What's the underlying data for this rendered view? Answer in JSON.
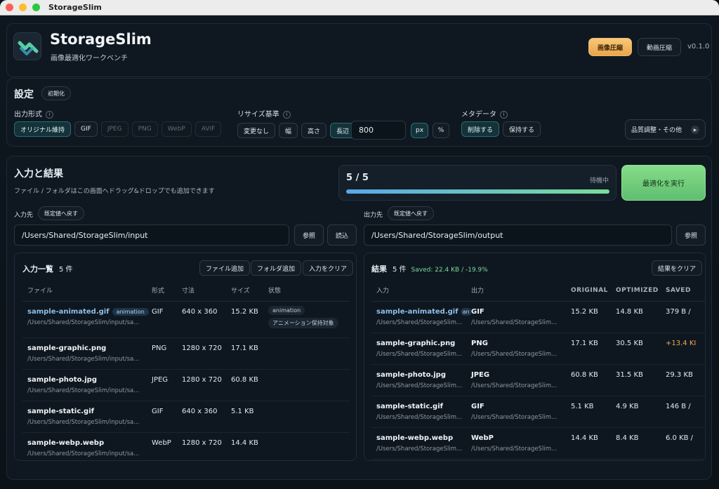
{
  "window": {
    "title": "StorageSlim"
  },
  "header": {
    "app_name": "StorageSlim",
    "subtitle": "画像最適化ワークベンチ",
    "tab_image": "画像圧縮",
    "tab_video": "動画圧縮",
    "version": "v0.1.0"
  },
  "settings": {
    "title": "設定",
    "reset": "初期化",
    "output_format": {
      "label": "出力形式",
      "info": "i",
      "options": [
        "オリジナル維持",
        "GIF",
        "JPEG",
        "PNG",
        "WebP",
        "AVIF"
      ],
      "selected": "オリジナル維持"
    },
    "resize": {
      "label": "リサイズ基準",
      "info": "i",
      "options": [
        "変更なし",
        "幅",
        "高さ",
        "長辺"
      ],
      "selected": "長辺",
      "value": "800",
      "unit_px": "px",
      "unit_pct": "%",
      "selected_unit": "px"
    },
    "metadata": {
      "label": "メタデータ",
      "info": "i",
      "options": [
        "削除する",
        "保持する"
      ],
      "selected": "削除する"
    },
    "quality_button": "品質調整・その他"
  },
  "io": {
    "title": "入力と結果",
    "hint": "ファイル / フォルダはこの画面へドラッグ&ドロップでも追加できます",
    "progress": {
      "text": "5 / 5",
      "status": "待機中",
      "fraction": 1.0
    },
    "run_button": "最適化を実行",
    "input_dir": {
      "label": "入力先",
      "reset": "既定値へ戻す",
      "value": "/Users/Shared/StorageSlim/input",
      "browse": "参照",
      "read": "読込"
    },
    "output_dir": {
      "label": "出力先",
      "reset": "既定値へ戻す",
      "value": "/Users/Shared/StorageSlim/output",
      "browse": "参照"
    }
  },
  "input_list": {
    "title": "入力一覧",
    "count": "5 件",
    "add_file": "ファイル追加",
    "add_folder": "フォルダ追加",
    "clear": "入力をクリア",
    "columns": [
      "ファイル",
      "形式",
      "寸法",
      "サイズ",
      "状態"
    ],
    "rows": [
      {
        "name": "sample-animated.gif",
        "badge": "animation",
        "path": "/Users/Shared/StorageSlim/input/sa...",
        "format": "GIF",
        "dims": "640 x 360",
        "size": "15.2 KB",
        "status1": "animation",
        "status2": "アニメーション保持対象"
      },
      {
        "name": "sample-graphic.png",
        "badge": "",
        "path": "/Users/Shared/StorageSlim/input/sa...",
        "format": "PNG",
        "dims": "1280 x 720",
        "size": "17.1 KB",
        "status1": "",
        "status2": ""
      },
      {
        "name": "sample-photo.jpg",
        "badge": "",
        "path": "/Users/Shared/StorageSlim/input/sa...",
        "format": "JPEG",
        "dims": "1280 x 720",
        "size": "60.8 KB",
        "status1": "",
        "status2": ""
      },
      {
        "name": "sample-static.gif",
        "badge": "",
        "path": "/Users/Shared/StorageSlim/input/sa...",
        "format": "GIF",
        "dims": "640 x 360",
        "size": "5.1 KB",
        "status1": "",
        "status2": ""
      },
      {
        "name": "sample-webp.webp",
        "badge": "",
        "path": "/Users/Shared/StorageSlim/input/sa...",
        "format": "WebP",
        "dims": "1280 x 720",
        "size": "14.4 KB",
        "status1": "",
        "status2": ""
      }
    ]
  },
  "results": {
    "title": "結果",
    "count": "5 件",
    "saved": "Saved: 22.4 KB / -19.9%",
    "clear": "結果をクリア",
    "columns": [
      "入力",
      "出力",
      "ORIGINAL",
      "OPTIMIZED",
      "SAVED"
    ],
    "rows": [
      {
        "name": "sample-animated.gif",
        "badge": "an",
        "path": "/Users/Shared/StorageSlim...",
        "out": "GIF",
        "out_path": "/Users/Shared/StorageSlim...",
        "orig": "15.2 KB",
        "opt": "14.8 KB",
        "saved": "379 B /",
        "warn": false
      },
      {
        "name": "sample-graphic.png",
        "badge": "",
        "path": "/Users/Shared/StorageSlim...",
        "out": "PNG",
        "out_path": "/Users/Shared/StorageSlim...",
        "orig": "17.1 KB",
        "opt": "30.5 KB",
        "saved": "+13.4 KI",
        "warn": true
      },
      {
        "name": "sample-photo.jpg",
        "badge": "",
        "path": "/Users/Shared/StorageSlim...",
        "out": "JPEG",
        "out_path": "/Users/Shared/StorageSlim...",
        "orig": "60.8 KB",
        "opt": "31.5 KB",
        "saved": "29.3 KB",
        "warn": false
      },
      {
        "name": "sample-static.gif",
        "badge": "",
        "path": "/Users/Shared/StorageSlim...",
        "out": "GIF",
        "out_path": "/Users/Shared/StorageSlim...",
        "orig": "5.1 KB",
        "opt": "4.9 KB",
        "saved": "146 B /",
        "warn": false
      },
      {
        "name": "sample-webp.webp",
        "badge": "",
        "path": "/Users/Shared/StorageSlim...",
        "out": "WebP",
        "out_path": "/Users/Shared/StorageSlim...",
        "orig": "14.4 KB",
        "opt": "8.4 KB",
        "saved": "6.0 KB /",
        "warn": false
      }
    ]
  },
  "colors": {
    "accent_orange": "#f4b55a",
    "accent_green": "#6fd07a",
    "progress_start": "#5aa7e8",
    "progress_end": "#7bdc9a",
    "warn": "#f0a94a"
  }
}
